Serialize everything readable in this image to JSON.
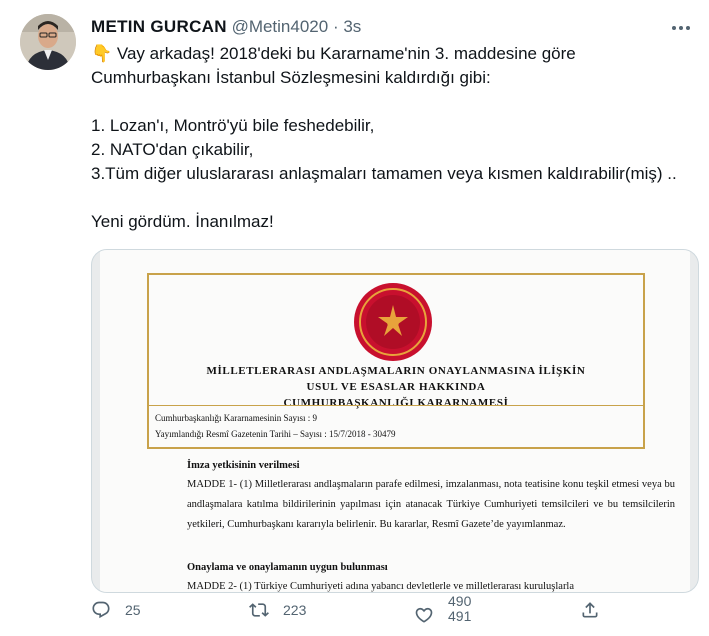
{
  "tweet": {
    "display_name": "METIN GURCAN",
    "handle": "@Metin4020",
    "separator": " · ",
    "time": "3s",
    "text": "👇 Vay arkadaş! 2018'deki bu Kararname'nin 3. maddesine göre\nCumhurbaşkanı İstanbul Sözleşmesini kaldırdığı gibi:\n\n1. Lozan'ı, Montrö'yü bile feshedebilir,\n2. NATO'dan çıkabilir,\n3.Tüm diğer uluslararası anlaşmaları tamamen veya kısmen kaldırabilir(miş) ..\n\nYeni gördüm. İnanılmaz!"
  },
  "document": {
    "title_line1": "MİLLETLERARASI ANDLAŞMALARIN ONAYLANMASINA İLİŞKİN",
    "title_line2": "USUL VE ESASLAR HAKKINDA",
    "title_line3": "CUMHURBAŞKANLIĞI KARARNAMESİ",
    "info_line1": "Cumhurbaşkanlığı Kararnamesinin Sayısı        : 9",
    "info_line2": "Yayımlandığı Resmî Gazetenin Tarihi – Sayısı : 15/7/2018 - 30479",
    "section1_heading": "İmza yetkisinin verilmesi",
    "article1": "MADDE 1- (1) Milletlerarası andlaşmaların parafe edilmesi, imzalanması, nota teatisine konu teşkil etmesi veya bu andlaşmalara katılma bildirilerinin yapılması için atanacak Türkiye Cumhuriyeti temsilcileri ve bu temsilcilerin yetkileri, Cumhurbaşkanı kararıyla belirlenir. Bu kararlar, Resmî Gazete’de yayımlanmaz.",
    "section2_heading": "Onaylama ve onaylamanın uygun bulunması",
    "article2": "MADDE 2- (1) Türkiye Cumhuriyeti adına yabancı devletlerle ve milletlerarası kuruluşlarla"
  },
  "actions": {
    "reply_count": "25",
    "retweet_count": "223",
    "like_count_line1": "490",
    "like_count_line2": "491"
  },
  "icons": {
    "reply": "reply-icon",
    "retweet": "retweet-icon",
    "like": "heart-icon",
    "share": "share-icon",
    "more": "more-icon"
  },
  "colors": {
    "secondary_text": "#536471",
    "border": "#cfd9de",
    "frame_gold": "#c8a24a",
    "emblem_red": "#c8102e"
  }
}
